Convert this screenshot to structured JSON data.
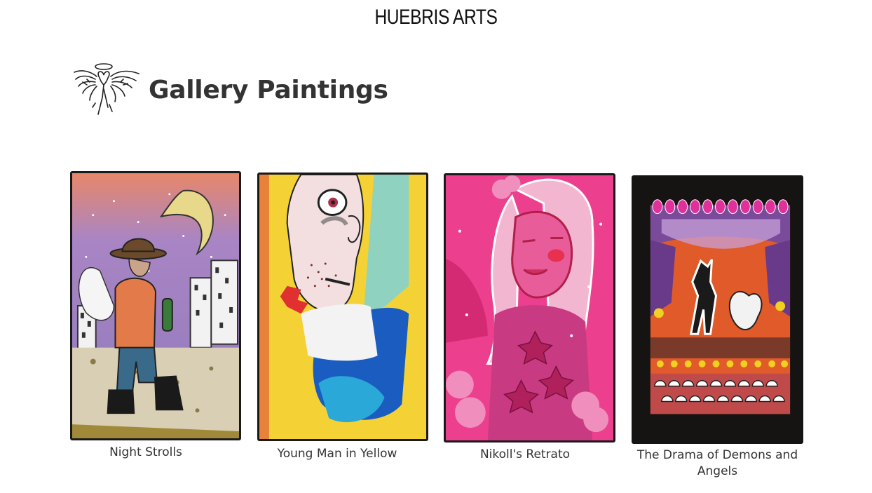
{
  "site": {
    "title": "HUEBRIS ARTS"
  },
  "page": {
    "title": "Gallery Paintings",
    "logo_icon": "angel-icon"
  },
  "gallery": {
    "items": [
      {
        "title": "Night Strolls"
      },
      {
        "title": "Young Man in Yellow"
      },
      {
        "title": "Nikoll's Retrato"
      },
      {
        "title": "The Drama of Demons and Angels"
      }
    ]
  }
}
